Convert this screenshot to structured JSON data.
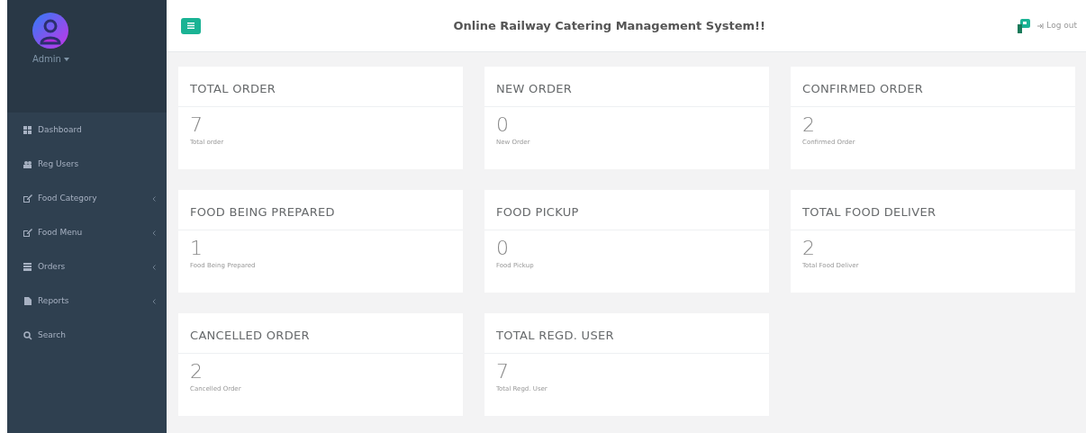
{
  "sidebar": {
    "user": {
      "name": "Admin"
    },
    "items": [
      {
        "label": "Dashboard",
        "kind": "grid",
        "has_submenu": false
      },
      {
        "label": "Reg Users",
        "kind": "users",
        "has_submenu": false
      },
      {
        "label": "Food Category",
        "kind": "edit",
        "has_submenu": true
      },
      {
        "label": "Food Menu",
        "kind": "edit",
        "has_submenu": true
      },
      {
        "label": "Orders",
        "kind": "table",
        "has_submenu": true
      },
      {
        "label": "Reports",
        "kind": "file",
        "has_submenu": true
      },
      {
        "label": "Search",
        "kind": "search",
        "has_submenu": false
      }
    ]
  },
  "header": {
    "title": "Online Railway Catering Management System!!",
    "logout": "Log out"
  },
  "stats": [
    {
      "title": "TOTAL ORDER",
      "value": "7",
      "caption": "Total order"
    },
    {
      "title": "NEW ORDER",
      "value": "0",
      "caption": "New Order"
    },
    {
      "title": "CONFIRMED ORDER",
      "value": "2",
      "caption": "Confirmed Order"
    },
    {
      "title": "FOOD BEING PREPARED",
      "value": "1",
      "caption": "Food Being Prepared"
    },
    {
      "title": "FOOD PICKUP",
      "value": "0",
      "caption": "Food Pickup"
    },
    {
      "title": "TOTAL FOOD DELIVER",
      "value": "2",
      "caption": "Total Food Deliver"
    },
    {
      "title": "CANCELLED ORDER",
      "value": "2",
      "caption": "Cancelled Order"
    },
    {
      "title": "TOTAL REGD. USER",
      "value": "7",
      "caption": "Total Regd. User"
    }
  ]
}
